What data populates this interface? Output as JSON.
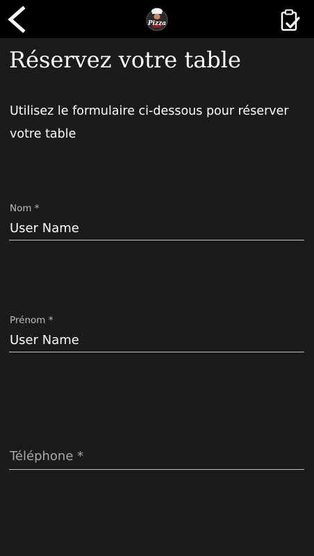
{
  "header": {
    "back_icon": "chevron-left-icon",
    "logo_text": "Pizza",
    "reserve_icon": "clipboard-check-icon"
  },
  "page": {
    "title": "Réservez votre table",
    "intro": "Utilisez le formulaire ci-dessous pour réserver votre table"
  },
  "form": {
    "nom": {
      "label": "Nom *",
      "value": "User Name"
    },
    "prenom": {
      "label": "Prénom *",
      "value": "User Name"
    },
    "telephone": {
      "placeholder": "Téléphone *",
      "value": ""
    }
  },
  "colors": {
    "background": "#1b1b1b",
    "header": "#000000",
    "text": "#ffffff",
    "label": "#bdbdbd",
    "underline": "#c4c4c4"
  }
}
